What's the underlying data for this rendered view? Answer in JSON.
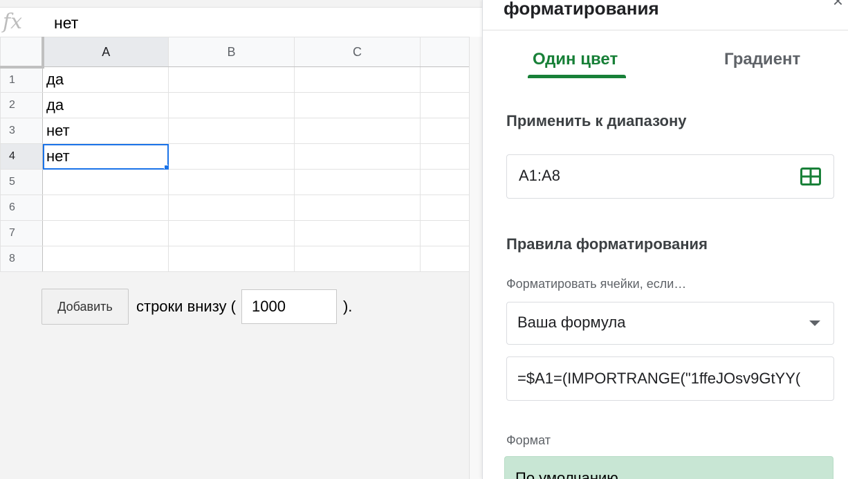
{
  "formula_bar": {
    "fx_symbol": "fx",
    "value": "нет"
  },
  "sheet": {
    "columns": [
      "A",
      "B",
      "C",
      ""
    ],
    "rows": [
      {
        "number": "1",
        "a": "да"
      },
      {
        "number": "2",
        "a": "да"
      },
      {
        "number": "3",
        "a": "нет"
      },
      {
        "number": "4",
        "a": "нет"
      },
      {
        "number": "5",
        "a": ""
      },
      {
        "number": "6",
        "a": ""
      },
      {
        "number": "7",
        "a": ""
      },
      {
        "number": "8",
        "a": ""
      }
    ],
    "selected_cell": "A4"
  },
  "add_rows": {
    "button_label": "Добавить",
    "text": "строки внизу (",
    "count": "1000",
    "tail": ")."
  },
  "panel": {
    "title": "форматирования",
    "close_symbol": "×",
    "tabs": [
      {
        "label": "Один цвет",
        "active": true
      },
      {
        "label": "Градиент",
        "active": false
      }
    ],
    "range_section_title": "Применить к диапазону",
    "range_value": "A1:A8",
    "rules_section_title": "Правила форматирования",
    "condition_label": "Форматировать ячейки, если…",
    "condition_value": "Ваша формула",
    "formula_value": "=$A1=(IMPORTRANGE(\"1ffeJOsv9GtYY(",
    "format_label": "Формат",
    "format_preview_text": "По умолчанию"
  },
  "colors": {
    "accent_green": "#188038",
    "selection_blue": "#1a73e8",
    "format_preview_bg": "#c8e6d4"
  },
  "icons": {
    "formula": "fx-icon",
    "range_select": "grid-icon",
    "dropdown": "caret-down-icon",
    "close": "close-icon"
  }
}
